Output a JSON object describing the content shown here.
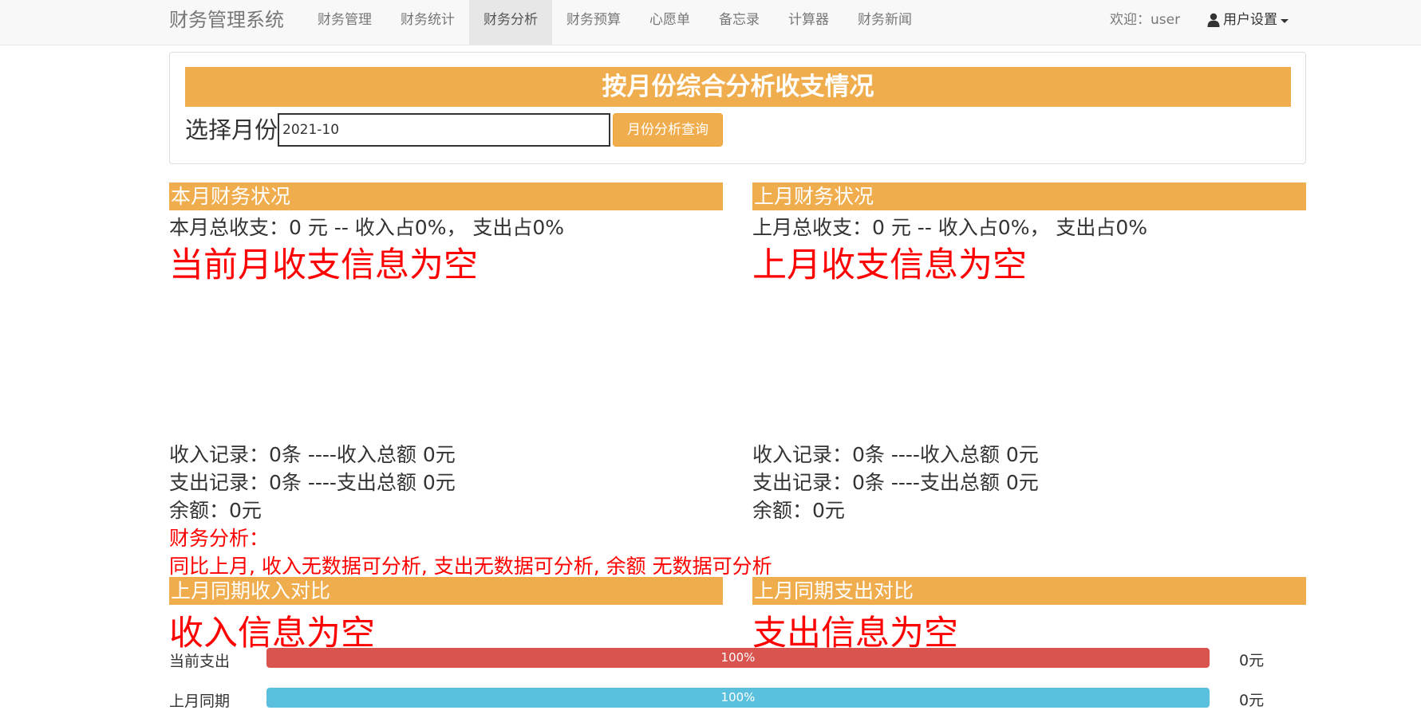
{
  "navbar": {
    "brand": "财务管理系统",
    "items": [
      "财务管理",
      "财务统计",
      "财务分析",
      "财务预算",
      "心愿单",
      "备忘录",
      "计算器",
      "财务新闻"
    ],
    "active_index": 2,
    "welcome": "欢迎：user",
    "user_menu": "用户设置"
  },
  "query": {
    "title": "按月份综合分析收支情况",
    "label": "选择月份",
    "month_value": "2021-10",
    "button": "月份分析查询"
  },
  "current": {
    "header": "本月财务状况",
    "summary": "本月总收支：0 元 -- 收入占0%， 支出占0%",
    "empty": "当前月收支信息为空",
    "income_record": "收入记录：0条 ----收入总额 0元",
    "expense_record": "支出记录：0条 ----支出总额 0元",
    "balance": "余额：0元",
    "analysis_label": "财务分析：",
    "analysis_text": "同比上月, 收入无数据可分析, 支出无数据可分析, 余额 无数据可分析"
  },
  "previous": {
    "header": "上月财务状况",
    "summary": "上月总收支：0 元 -- 收入占0%， 支出占0%",
    "empty": "上月收支信息为空",
    "income_record": "收入记录：0条 ----收入总额 0元",
    "expense_record": "支出记录：0条 ----支出总额 0元",
    "balance": "余额：0元"
  },
  "income_compare": {
    "header": "上月同期收入对比",
    "empty": "收入信息为空"
  },
  "expense_compare": {
    "header": "上月同期支出对比",
    "empty": "支出信息为空"
  },
  "bars": [
    {
      "label": "当前支出",
      "percent": 100,
      "percent_text": "100%",
      "value": "0元",
      "color": "#d9534f"
    },
    {
      "label": "上月同期",
      "percent": 100,
      "percent_text": "100%",
      "value": "0元",
      "color": "#5bc0de"
    }
  ],
  "colors": {
    "accent": "#f0ad4e",
    "danger": "#ff0000",
    "bar_danger": "#d9534f",
    "bar_info": "#5bc0de"
  }
}
